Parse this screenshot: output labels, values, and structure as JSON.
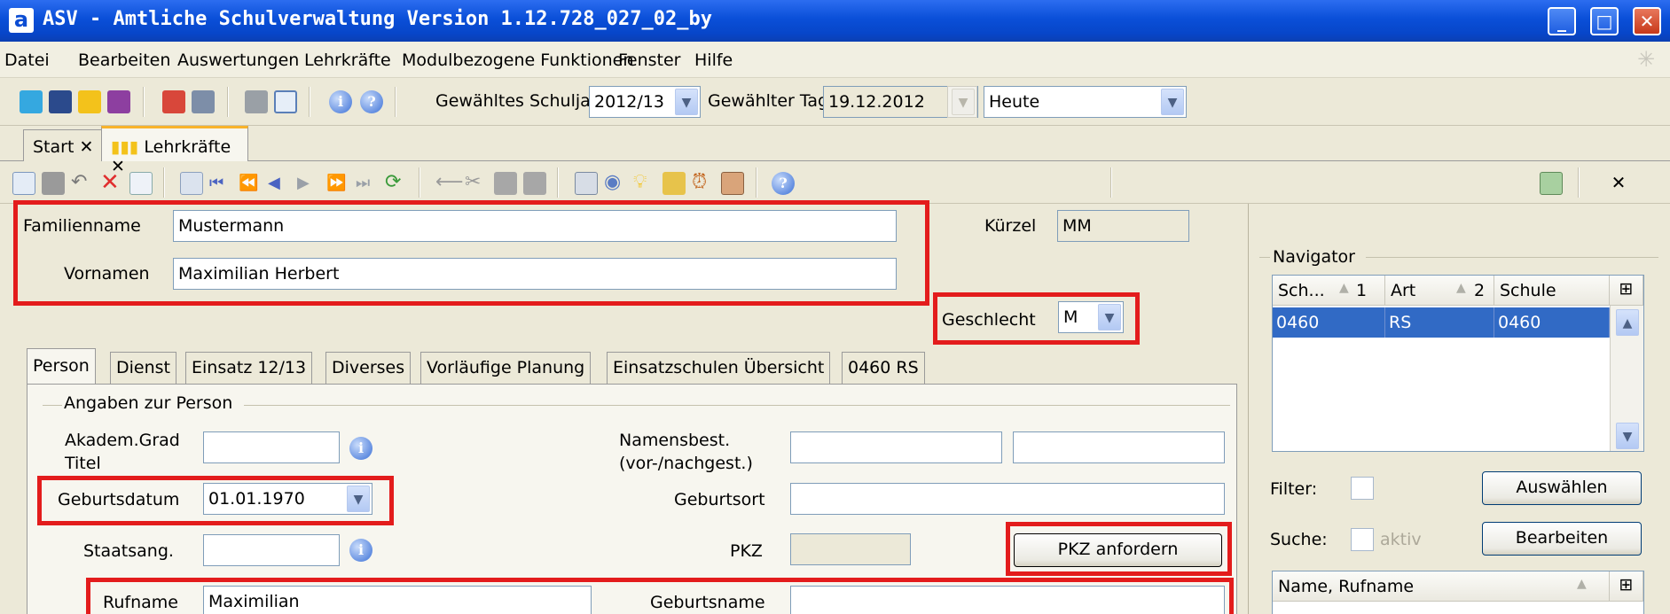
{
  "window": {
    "title": "ASV - Amtliche Schulverwaltung Version 1.12.728_027_02_by",
    "app_icon": "a"
  },
  "menu": [
    "Datei",
    "Bearbeiten",
    "Auswertungen",
    "Lehrkräfte",
    "Modulbezogene Funktionen",
    "Fenster",
    "Hilfe"
  ],
  "toolbar": {
    "schuljahr_label": "Gewähltes Schuljahr",
    "schuljahr_value": "2012/13",
    "tag_label": "Gewählter Tag",
    "tag_value": "19.12.2012",
    "heute_value": "Heute"
  },
  "tabs": [
    {
      "label": "Start"
    },
    {
      "label": "Lehrkräfte"
    }
  ],
  "person": {
    "familienname_label": "Familienname",
    "familienname_value": "Mustermann",
    "vornamen_label": "Vornamen",
    "vornamen_value": "Maximilian Herbert",
    "kuerzel_label": "Kürzel",
    "kuerzel_value": "MM",
    "geschlecht_label": "Geschlecht",
    "geschlecht_value": "M"
  },
  "subtabs": [
    "Person",
    "Dienst",
    "Einsatz 12/13",
    "Diverses",
    "Vorläufige Planung",
    "Einsatzschulen Übersicht",
    "0460 RS"
  ],
  "angaben": {
    "legend": "Angaben zur Person",
    "akadem_label": "Akadem.Grad\nTitel",
    "namensbest_label": "Namensbest.\n(vor-/nachgest.)",
    "geburtsdatum_label": "Geburtsdatum",
    "geburtsdatum_value": "01.01.1970",
    "geburtsort_label": "Geburtsort",
    "staatsang_label": "Staatsang.",
    "pkz_label": "PKZ",
    "pkz_button": "PKZ anfordern",
    "rufname_label": "Rufname",
    "rufname_value": "Maximilian",
    "geburtsname_label": "Geburtsname"
  },
  "navigator": {
    "legend": "Navigator",
    "columns": [
      "Sch...",
      "Art",
      "Schule"
    ],
    "sort_markers": [
      "1",
      "2"
    ],
    "rows": [
      [
        "0460",
        "RS",
        "0460"
      ]
    ],
    "filter_label": "Filter:",
    "suche_label": "Suche:",
    "aktiv_label": "aktiv",
    "auswaehlen_button": "Auswählen",
    "bearbeiten_button": "Bearbeiten",
    "list_header": "Name, Rufname"
  }
}
